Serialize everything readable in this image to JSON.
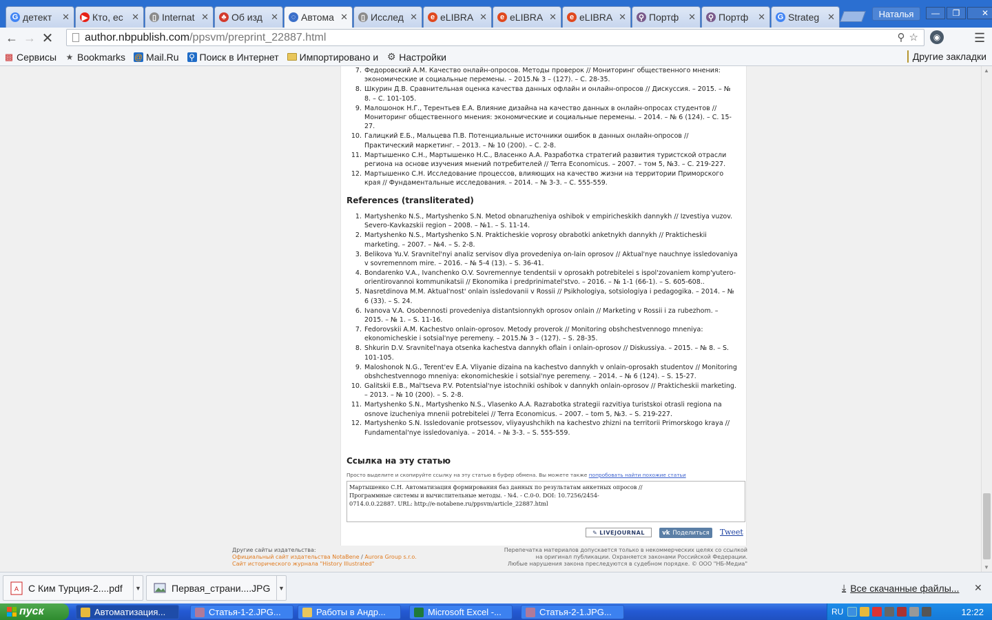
{
  "browser": {
    "tabs": [
      {
        "title": "детект",
        "icon": "google-icon",
        "color": "#4285f4",
        "glyph": "G"
      },
      {
        "title": "Кто, ес",
        "icon": "youtube-icon",
        "color": "#e62117",
        "glyph": "▶"
      },
      {
        "title": "Internat",
        "icon": "page-icon",
        "color": "#8a8a8a",
        "glyph": "▯"
      },
      {
        "title": "Об изд",
        "icon": "publisher-icon",
        "color": "#d33a2c",
        "glyph": "♣"
      },
      {
        "title": "Автома",
        "icon": "loading-icon",
        "color": "#3b6fc9",
        "glyph": "◌"
      },
      {
        "title": "Исслед",
        "icon": "page-icon",
        "color": "#8a8a8a",
        "glyph": "▯"
      },
      {
        "title": "eLIBRA",
        "icon": "elibrary-icon",
        "color": "#e0491f",
        "glyph": "e"
      },
      {
        "title": "eLIBRA",
        "icon": "elibrary-icon",
        "color": "#e0491f",
        "glyph": "e"
      },
      {
        "title": "eLIBRA",
        "icon": "elibrary-icon",
        "color": "#e0491f",
        "glyph": "e"
      },
      {
        "title": "Портф",
        "icon": "portfolio-icon",
        "color": "#7a5a8a",
        "glyph": "⚲"
      },
      {
        "title": "Портф",
        "icon": "portfolio-icon",
        "color": "#7a5a8a",
        "glyph": "⚲"
      },
      {
        "title": "Strateg",
        "icon": "google-icon",
        "color": "#4285f4",
        "glyph": "G"
      }
    ],
    "active_tab": 4,
    "user_name": "Наталья",
    "window_controls": {
      "minimize": "—",
      "restore": "❐",
      "close": "✕"
    },
    "url_host": "author.nbpublish.com",
    "url_path": "/ppsvm/preprint_22887.html",
    "bookmarks": [
      {
        "label": "Сервисы",
        "icon": "apps-icon"
      },
      {
        "label": "Bookmarks",
        "icon": "star-icon"
      },
      {
        "label": "Mail.Ru",
        "icon": "mailru-icon"
      },
      {
        "label": "Поиск в Интернет",
        "icon": "search-icon"
      },
      {
        "label": "Импортировано и",
        "icon": "folder-icon"
      },
      {
        "label": "Настройки",
        "icon": "gear-icon"
      }
    ],
    "other_bookmarks": "Другие закладки"
  },
  "page": {
    "refs_ru": [
      {
        "n": "7.",
        "text": "Федоровский А.М. Качество онлайн-опросов. Методы проверок // Мониторинг общественного мнения: экономические и социальные перемены. – 2015.№ 3 – (127). – С. 28-35."
      },
      {
        "n": "8.",
        "text": "Шкурин Д.В. Сравнительная оценка качества данных офлайн и онлайн-опросов // Дискуссия. – 2015. – № 8. – С. 101-105."
      },
      {
        "n": "9.",
        "text": "Малошонок Н.Г., Терентьев Е.А. Влияние дизайна на качество данных в онлайн-опросах студентов // Мониторинг общественного мнения: экономические и социальные перемены. – 2014. – № 6 (124). – С. 15-27."
      },
      {
        "n": "10.",
        "text": "Галицкий Е.Б., Мальцева П.В. Потенциальные источники ошибок в данных онлайн-опросов // Практический маркетинг. – 2013. – № 10 (200). – С. 2-8."
      },
      {
        "n": "11.",
        "text": "Мартышенко С.Н., Мартышенко Н.С., Власенко А.А. Разработка стратегий развития туристской отрасли региона на основе изучения мнений потребителей // Terra Economicus. – 2007. – том 5, №3. – С. 219-227."
      },
      {
        "n": "12.",
        "text": "Мартышенко С.Н. Исследование процессов, влияющих на качество жизни на территории Приморского края // Фундаментальные исследования. – 2014. – № 3-3. – С. 555-559."
      }
    ],
    "refs_translit_heading": "References (transliterated)",
    "refs_tr": [
      {
        "n": "1.",
        "text": "Martyshenko N.S., Martyshenko S.N. Metod obnaruzheniya oshibok v empiricheskikh dannykh // Izvestiya vuzov. Severo-Kavkazskii region – 2008. – №1. – S. 11-14."
      },
      {
        "n": "2.",
        "text": "Martyshenko N.S., Martyshenko S.N. Prakticheskie voprosy obrabotki anketnykh dannykh // Prakticheskii marketing. – 2007. – №4. – S. 2-8."
      },
      {
        "n": "3.",
        "text": "Belikova Yu.V. Sravnitel'nyi analiz servisov dlya provedeniya on-lain oprosov // Aktual'nye nauchnye issledovaniya v sovremennom mire. – 2016. – № 5-4 (13). – S. 36-41."
      },
      {
        "n": "4.",
        "text": "Bondarenko V.A., Ivanchenko O.V. Sovremennye tendentsii v oprosakh potrebitelei s ispol'zovaniem komp'yutero-orientirovannoi kommunikatsii // Ekonomika i predprinimatel'stvo. – 2016. – № 1-1 (66-1). – S. 605-608.."
      },
      {
        "n": "5.",
        "text": "Nasretdinova M.M. Aktual'nost' onlain issledovanii v Rossii // Psikhologiya, sotsiologiya i pedagogika. – 2014. – № 6 (33). – S. 24."
      },
      {
        "n": "6.",
        "text": "Ivanova V.A. Osobennosti provedeniya distantsionnykh oprosov onlain // Marketing v Rossii i za rubezhom. – 2015. – № 1. – S. 11-16."
      },
      {
        "n": "7.",
        "text": "Fedorovskii A.M. Kachestvo onlain-oprosov. Metody proverok // Monitoring obshchestvennogo mneniya: ekonomicheskie i sotsial'nye peremeny. – 2015.№ 3 – (127). – S. 28-35."
      },
      {
        "n": "8.",
        "text": "Shkurin D.V. Sravnitel'naya otsenka kachestva dannykh oflain i onlain-oprosov // Diskussiya. – 2015. – № 8. – S. 101-105."
      },
      {
        "n": "9.",
        "text": "Maloshonok N.G., Terent'ev E.A. Vliyanie dizaina na kachestvo dannykh v onlain-oprosakh studentov // Monitoring obshchestvennogo mneniya: ekonomicheskie i sotsial'nye peremeny. – 2014. – № 6 (124). – S. 15-27."
      },
      {
        "n": "10.",
        "text": "Galitskii E.B., Mal'tseva P.V. Potentsial'nye istochniki oshibok v dannykh onlain-oprosov // Prakticheskii marketing. – 2013. – № 10 (200). – S. 2-8."
      },
      {
        "n": "11.",
        "text": "Martyshenko S.N., Martyshenko N.S., Vlasenko A.A. Razrabotka strategii razvitiya turistskoi otrasli regiona na osnove izucheniya mnenii potrebitelei // Terra Economicus. – 2007. – tom 5, №3. – S. 219-227."
      },
      {
        "n": "12.",
        "text": "Martyshenko S.N. Issledovanie protsessov, vliyayushchikh na kachestvo zhizni na territorii Primorskogo kraya // Fundamental'nye issledovaniya. – 2014. – № 3-3. – S. 555-559."
      }
    ],
    "cite_heading": "Ссылка на эту статью",
    "cite_hint": "Просто выделите и скопируйте ссылку на эту статью в буфер обмена. Вы можете также",
    "cite_hint_link": "попробовать найти похожие статьи",
    "cite_text": "Мартышенко С.Н. Автоматизация формирования баз данных по результатам анкетных опросов //\nПрограммные системы и вычислительные методы. - №4. - С.0-0. DOI: 10.7256/2454-\n0714.0.0.22887. URL: http://e-notabene.ru/ppsvm/article_22887.html",
    "share_lj": "LIVEJOURNAL",
    "share_vk": "Поделиться",
    "share_tweet": "Tweet",
    "footer_left_title": "Другие сайты издательства:",
    "footer_left_line1_a": "Официальный сайт издательства NotaBene",
    "footer_left_line1_sep": " / ",
    "footer_left_line1_b": "Aurora Group s.r.o.",
    "footer_left_line2": "Сайт исторического журнала \"History Illustrated\"",
    "footer_right_1": "Перепечатка материалов допускается только в некоммерческих целях со ссылкой",
    "footer_right_2": "на оригинал публикации. Охраняется законами Российской Федерации.",
    "footer_right_3": "Любые нарушения закона преследуются в судебном порядке. © ООО \"НБ-Медиа\""
  },
  "downloads": {
    "items": [
      {
        "name": "С Ким Турция-2....pdf",
        "icon": "pdf-icon"
      },
      {
        "name": "Первая_страни....JPG",
        "icon": "image-icon"
      }
    ],
    "show_all": "Все скачанные файлы...",
    "close": "✕"
  },
  "taskbar": {
    "start_label": "пуск",
    "items": [
      {
        "label": "Автоматизация...",
        "icon": "chrome-icon",
        "color": "#e8b93c",
        "active": true
      },
      {
        "label": "Статья-1-2.JPG...",
        "icon": "image-viewer-icon",
        "color": "#b07a9a",
        "active": false
      },
      {
        "label": "Работы в Андр...",
        "icon": "folder-icon",
        "color": "#e8c65c",
        "active": false
      },
      {
        "label": "Microsoft Excel -...",
        "icon": "excel-icon",
        "color": "#1f7a3a",
        "active": false
      },
      {
        "label": "Статья-2-1.JPG...",
        "icon": "image-viewer-icon",
        "color": "#b07a9a",
        "active": false
      }
    ],
    "lang": "RU",
    "clock": "12:22"
  }
}
